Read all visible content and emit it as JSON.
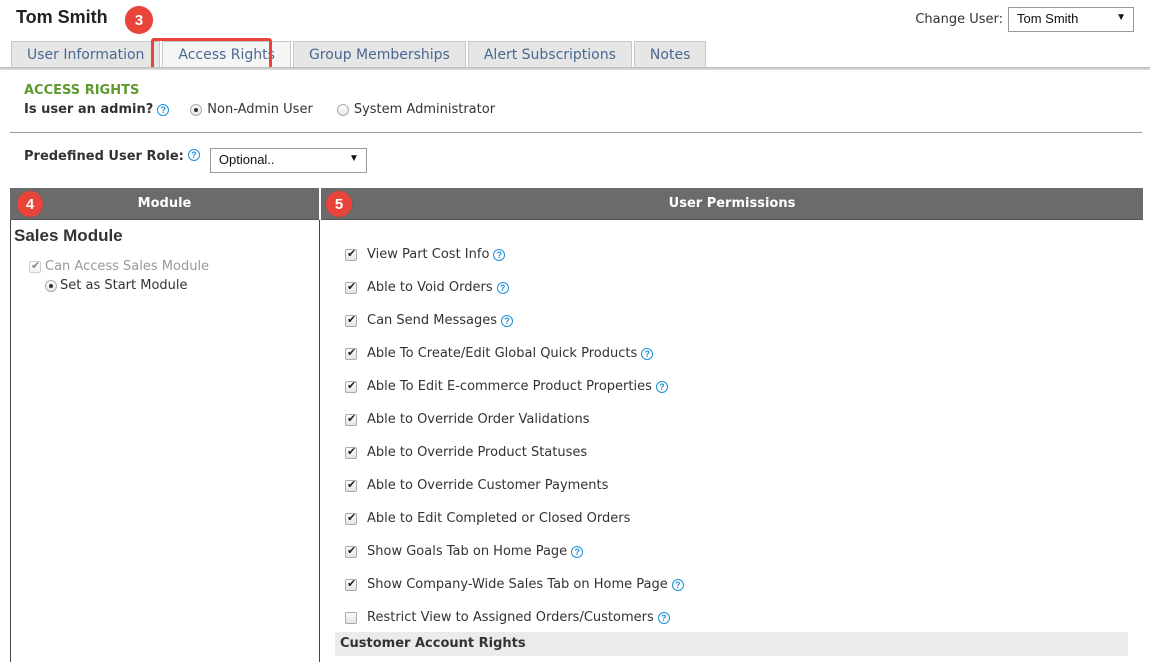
{
  "header": {
    "user_name": "Tom Smith",
    "change_user_label": "Change User:",
    "change_user_value": "Tom Smith"
  },
  "callouts": {
    "tabs": "3",
    "module": "4",
    "permissions": "5",
    "color": "#e8443a"
  },
  "tabs": [
    {
      "label": "User Information",
      "active": false
    },
    {
      "label": "Access Rights",
      "active": true
    },
    {
      "label": "Group Memberships",
      "active": false
    },
    {
      "label": "Alert Subscriptions",
      "active": false
    },
    {
      "label": "Notes",
      "active": false
    }
  ],
  "access_rights": {
    "title": "ACCESS RIGHTS",
    "admin_question": "Is user an admin?",
    "admin_options": [
      {
        "label": "Non-Admin User",
        "selected": true
      },
      {
        "label": "System Administrator",
        "selected": false
      }
    ],
    "role_label": "Predefined User Role:",
    "role_value": "Optional.."
  },
  "grid": {
    "module_header": "Module",
    "permissions_header": "User Permissions"
  },
  "module": {
    "title": "Sales Module",
    "can_access_label": "Can Access Sales Module",
    "can_access_checked": true,
    "start_module_label": "Set as Start Module",
    "start_module_selected": true
  },
  "permissions": [
    {
      "label": "View Part Cost Info",
      "checked": true,
      "help": true
    },
    {
      "label": "Able to Void Orders",
      "checked": true,
      "help": true
    },
    {
      "label": "Can Send Messages",
      "checked": true,
      "help": true
    },
    {
      "label": "Able To Create/Edit Global Quick Products",
      "checked": true,
      "help": true
    },
    {
      "label": "Able To Edit E-commerce Product Properties",
      "checked": true,
      "help": true
    },
    {
      "label": "Able to Override Order Validations",
      "checked": true,
      "help": false
    },
    {
      "label": "Able to Override Product Statuses",
      "checked": true,
      "help": false
    },
    {
      "label": "Able to Override Customer Payments",
      "checked": true,
      "help": false
    },
    {
      "label": "Able to Edit Completed or Closed Orders",
      "checked": true,
      "help": false
    },
    {
      "label": "Show Goals Tab on Home Page",
      "checked": true,
      "help": true
    },
    {
      "label": "Show Company-Wide Sales Tab on Home Page",
      "checked": true,
      "help": true
    },
    {
      "label": "Restrict View to Assigned Orders/Customers",
      "checked": false,
      "help": true
    }
  ],
  "customer_section": {
    "title": "Customer Account Rights"
  }
}
